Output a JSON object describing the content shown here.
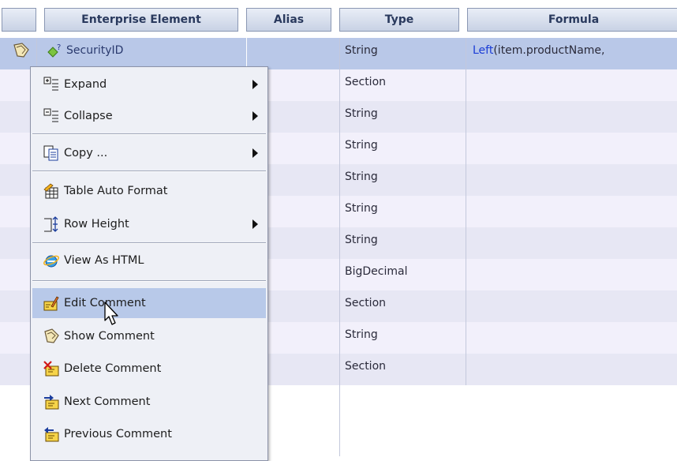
{
  "table": {
    "columns": {
      "enterprise_element": "Enterprise Element",
      "alias": "Alias",
      "type": "Type",
      "formula": "Formula"
    },
    "rows": [
      {
        "element": "SecurityID",
        "type": "String",
        "formula_fn": "Left",
        "formula_rest": "(item.productName,"
      },
      {
        "element": "",
        "type": "Section",
        "formula_fn": "",
        "formula_rest": ""
      },
      {
        "element": "",
        "type": "String",
        "formula_fn": "",
        "formula_rest": ""
      },
      {
        "element": "",
        "type": "String",
        "formula_fn": "",
        "formula_rest": ""
      },
      {
        "element": "",
        "type": "String",
        "formula_fn": "",
        "formula_rest": ""
      },
      {
        "element": "",
        "type": "String",
        "formula_fn": "",
        "formula_rest": ""
      },
      {
        "element": "",
        "type": "String",
        "formula_fn": "",
        "formula_rest": ""
      },
      {
        "element": "",
        "type": "BigDecimal",
        "formula_fn": "",
        "formula_rest": ""
      },
      {
        "element": "",
        "type": "Section",
        "formula_fn": "",
        "formula_rest": ""
      },
      {
        "element": "",
        "type": "String",
        "formula_fn": "",
        "formula_rest": ""
      },
      {
        "element": "",
        "type": "Section",
        "formula_fn": "",
        "formula_rest": ""
      }
    ],
    "colors": {
      "selected_row": "#b9c8e8",
      "row_a": "#f2f0fb",
      "row_b": "#e7e7f4",
      "formula_keyword": "#1a3cd6"
    }
  },
  "context_menu": {
    "items": [
      {
        "label": "Expand",
        "icon": "expand-icon",
        "submenu": true
      },
      {
        "label": "Collapse",
        "icon": "collapse-icon",
        "submenu": true
      },
      {
        "label": "Copy ...",
        "icon": "copy-icon",
        "submenu": true
      },
      {
        "label": "Table Auto Format",
        "icon": "auto-format-icon",
        "submenu": false
      },
      {
        "label": "Row Height",
        "icon": "row-height-icon",
        "submenu": true
      },
      {
        "label": "View As HTML",
        "icon": "ie-globe-icon",
        "submenu": false
      },
      {
        "label": "Edit Comment",
        "icon": "edit-comment-icon",
        "submenu": false
      },
      {
        "label": "Show Comment",
        "icon": "show-comment-icon",
        "submenu": false
      },
      {
        "label": "Delete Comment",
        "icon": "delete-comment-icon",
        "submenu": false
      },
      {
        "label": "Next Comment",
        "icon": "next-comment-icon",
        "submenu": false
      },
      {
        "label": "Previous Comment",
        "icon": "previous-comment-icon",
        "submenu": false
      }
    ],
    "hovered_item": "Edit Comment",
    "hover_color": "#b8c9e9"
  }
}
